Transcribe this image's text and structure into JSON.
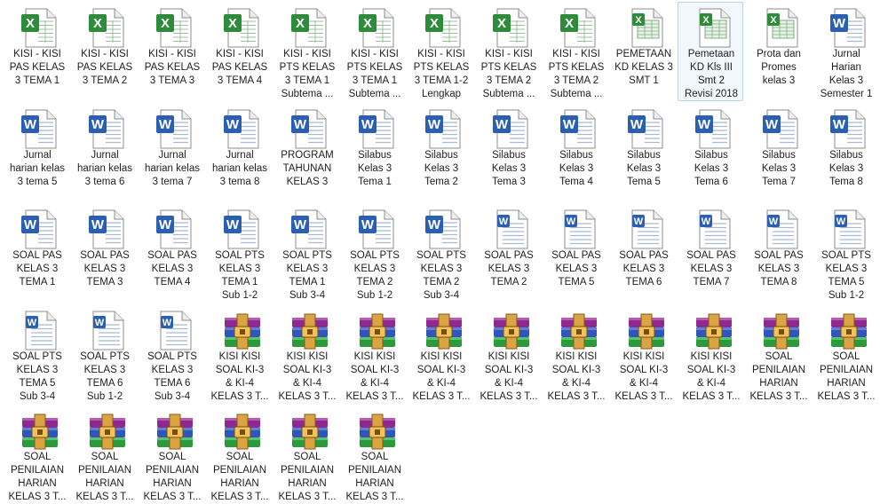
{
  "window": {
    "title": ""
  },
  "files": [
    {
      "name": "KISI - KISI\nPAS KELAS\n3 TEMA 1",
      "type": "excel"
    },
    {
      "name": "KISI - KISI\nPAS KELAS\n3 TEMA 2",
      "type": "excel"
    },
    {
      "name": "KISI - KISI\nPAS KELAS\n3 TEMA 3",
      "type": "excel"
    },
    {
      "name": "KISI - KISI\nPAS KELAS\n3 TEMA 4",
      "type": "excel"
    },
    {
      "name": "KISI - KISI\nPTS KELAS\n3 TEMA 1\nSubtema ...",
      "type": "excel"
    },
    {
      "name": "KISI - KISI\nPTS KELAS\n3 TEMA 1\nSubtema ...",
      "type": "excel"
    },
    {
      "name": "KISI - KISI\nPTS KELAS\n3 TEMA 1-2\nLengkap",
      "type": "excel"
    },
    {
      "name": "KISI - KISI\nPTS KELAS\n3 TEMA 2\nSubtema ...",
      "type": "excel"
    },
    {
      "name": "KISI - KISI\nPTS KELAS\n3 TEMA 2\nSubtema ...",
      "type": "excel"
    },
    {
      "name": "PEMETAAN\nKD KELAS 3\nSMT 1",
      "type": "excel-x"
    },
    {
      "name": "Pemetaan\nKD Kls III\nSmt 2\nRevisi 2018",
      "type": "excel-x",
      "selected": true
    },
    {
      "name": "Prota dan\nPromes\nkelas 3",
      "type": "excel-x"
    },
    {
      "name": "Jurnal\nHarian\nKelas 3\nSemester 1",
      "type": "word"
    },
    {
      "name": "Jurnal\nharian kelas\n3 tema 5",
      "type": "word"
    },
    {
      "name": "Jurnal\nharian kelas\n3 tema 6",
      "type": "word"
    },
    {
      "name": "Jurnal\nharian kelas\n3 tema 7",
      "type": "word"
    },
    {
      "name": "Jurnal\nharian kelas\n3 tema 8",
      "type": "word"
    },
    {
      "name": "PROGRAM\nTAHUNAN\nKELAS 3",
      "type": "word"
    },
    {
      "name": "Silabus\nKelas 3\nTema 1",
      "type": "word"
    },
    {
      "name": "Silabus\nKelas 3\nTema 2",
      "type": "word"
    },
    {
      "name": "Silabus\nKelas 3\nTema 3",
      "type": "word"
    },
    {
      "name": "Silabus\nKelas 3\nTema 4",
      "type": "word"
    },
    {
      "name": "Silabus\nKelas 3\nTema 5",
      "type": "word"
    },
    {
      "name": "Silabus\nKelas 3\nTema 6",
      "type": "word"
    },
    {
      "name": "Silabus\nKelas 3\nTema 7",
      "type": "word"
    },
    {
      "name": "Silabus\nKelas 3\nTema 8",
      "type": "word"
    },
    {
      "name": "SOAL PAS\nKELAS 3\nTEMA 1",
      "type": "word"
    },
    {
      "name": "SOAL PAS\nKELAS 3\nTEMA 3",
      "type": "word"
    },
    {
      "name": "SOAL PAS\nKELAS 3\nTEMA 4",
      "type": "word"
    },
    {
      "name": "SOAL PTS\nKELAS 3\nTEMA 1\nSub 1-2",
      "type": "word"
    },
    {
      "name": "SOAL PTS\nKELAS 3\nTEMA 1\nSub 3-4",
      "type": "word"
    },
    {
      "name": "SOAL PTS\nKELAS 3\nTEMA 2\nSub 1-2",
      "type": "word"
    },
    {
      "name": "SOAL PTS\nKELAS 3\nTEMA 2\nSub 3-4",
      "type": "word"
    },
    {
      "name": "SOAL PAS\nKELAS 3\nTEMA 2",
      "type": "word-x"
    },
    {
      "name": "SOAL PAS\nKELAS 3\nTEMA 5",
      "type": "word-x"
    },
    {
      "name": "SOAL PAS\nKELAS 3\nTEMA 6",
      "type": "word-x"
    },
    {
      "name": "SOAL PAS\nKELAS 3\nTEMA 7",
      "type": "word-x"
    },
    {
      "name": "SOAL PAS\nKELAS 3\nTEMA 8",
      "type": "word-x"
    },
    {
      "name": "SOAL PTS\nKELAS 3\nTEMA 5\nSub 1-2",
      "type": "word-x"
    },
    {
      "name": "SOAL PTS\nKELAS 3\nTEMA 5\nSub 3-4",
      "type": "word-x"
    },
    {
      "name": "SOAL PTS\nKELAS 3\nTEMA 6\nSub 1-2",
      "type": "word-x"
    },
    {
      "name": "SOAL PTS\nKELAS 3\nTEMA 6\nSub 3-4",
      "type": "word-x"
    },
    {
      "name": "KISI KISI\nSOAL KI-3\n& KI-4\nKELAS 3 T...",
      "type": "rar"
    },
    {
      "name": "KISI KISI\nSOAL KI-3\n& KI-4\nKELAS 3 T...",
      "type": "rar"
    },
    {
      "name": "KISI KISI\nSOAL KI-3\n& KI-4\nKELAS 3 T...",
      "type": "rar"
    },
    {
      "name": "KISI KISI\nSOAL KI-3\n& KI-4\nKELAS 3 T...",
      "type": "rar"
    },
    {
      "name": "KISI KISI\nSOAL KI-3\n& KI-4\nKELAS 3 T...",
      "type": "rar"
    },
    {
      "name": "KISI KISI\nSOAL KI-3\n& KI-4\nKELAS 3 T...",
      "type": "rar"
    },
    {
      "name": "KISI KISI\nSOAL KI-3\n& KI-4\nKELAS 3 T...",
      "type": "rar"
    },
    {
      "name": "KISI KISI\nSOAL KI-3\n& KI-4\nKELAS 3 T...",
      "type": "rar"
    },
    {
      "name": "SOAL\nPENILAIAN\nHARIAN\nKELAS 3 T...",
      "type": "rar"
    },
    {
      "name": "SOAL\nPENILAIAN\nHARIAN\nKELAS 3 T...",
      "type": "rar"
    },
    {
      "name": "SOAL\nPENILAIAN\nHARIAN\nKELAS 3 T...",
      "type": "rar"
    },
    {
      "name": "SOAL\nPENILAIAN\nHARIAN\nKELAS 3 T...",
      "type": "rar"
    },
    {
      "name": "SOAL\nPENILAIAN\nHARIAN\nKELAS 3 T...",
      "type": "rar"
    },
    {
      "name": "SOAL\nPENILAIAN\nHARIAN\nKELAS 3 T...",
      "type": "rar"
    },
    {
      "name": "SOAL\nPENILAIAN\nHARIAN\nKELAS 3 T...",
      "type": "rar"
    },
    {
      "name": "SOAL\nPENILAIAN\nHARIAN\nKELAS 3 T...",
      "type": "rar"
    }
  ],
  "colors": {
    "excel_green": "#2e8b3a",
    "word_blue": "#2b5fb4",
    "selection_bg": "#f2f7fd",
    "selection_border": "#bcd3ee"
  },
  "icons": {
    "excel": "excel-file-icon",
    "excel-x": "excel-xlsx-file-icon",
    "word": "word-file-icon",
    "word-x": "word-docx-file-icon",
    "rar": "winrar-archive-icon"
  }
}
